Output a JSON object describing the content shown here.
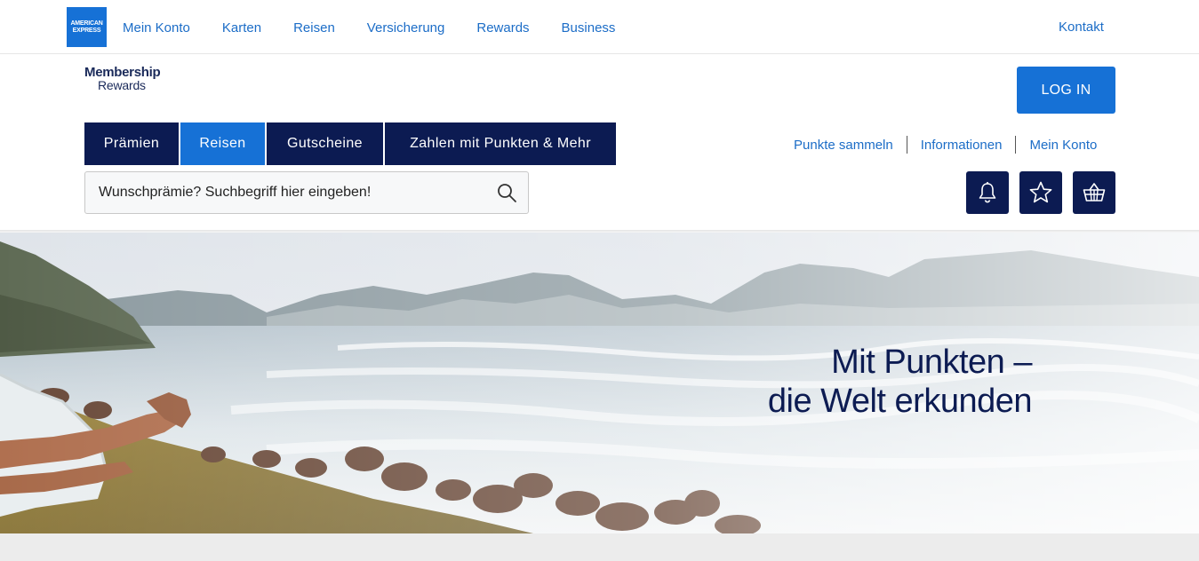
{
  "brand": {
    "amex_logo_lines": [
      "AMERICAN",
      "EXPRESS"
    ],
    "amex_color": "#1671d6",
    "navy": "#0c1b52"
  },
  "topnav": {
    "links": [
      "Mein Konto",
      "Karten",
      "Reisen",
      "Versicherung",
      "Rewards",
      "Business"
    ],
    "contact": "Kontakt"
  },
  "membership_logo": {
    "line1": "Membership",
    "line2": "Rewards"
  },
  "login_label": "LOG IN",
  "categories": [
    {
      "label": "Prämien",
      "active": false
    },
    {
      "label": "Reisen",
      "active": true
    },
    {
      "label": "Gutscheine",
      "active": false
    },
    {
      "label": "Zahlen mit Punkten & Mehr",
      "active": false
    }
  ],
  "util_links": [
    "Punkte sammeln",
    "Informationen",
    "Mein Konto"
  ],
  "search": {
    "placeholder": "Wunschprämie? Suchbegriff hier eingeben!",
    "icon": "search-icon"
  },
  "icon_buttons": [
    "bell-icon",
    "star-icon",
    "basket-icon"
  ],
  "hero": {
    "line1": "Mit Punkten –",
    "line2": "die Welt erkunden"
  }
}
